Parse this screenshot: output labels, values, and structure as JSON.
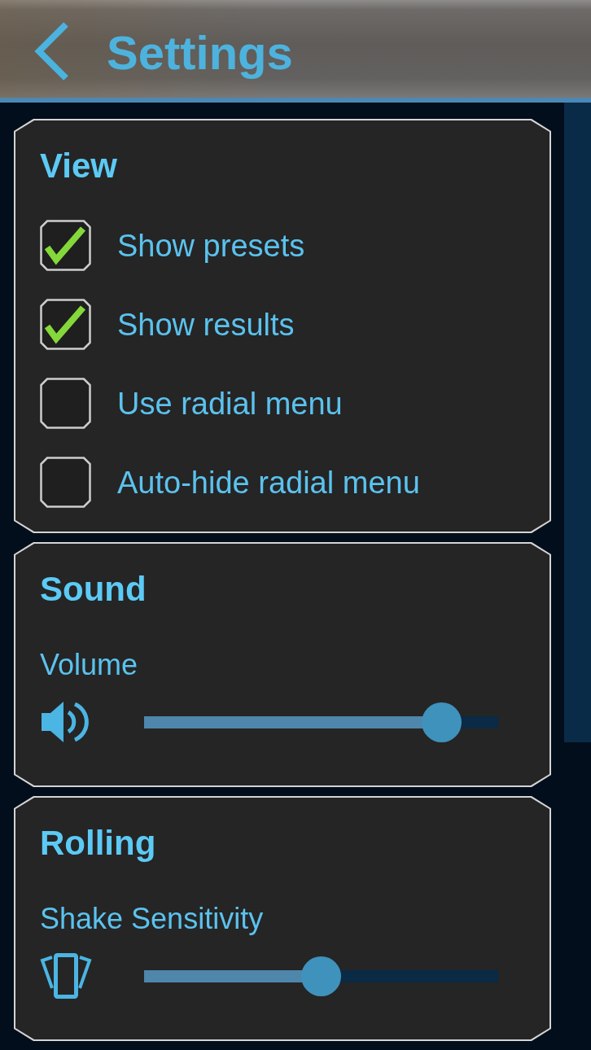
{
  "header": {
    "title": "Settings"
  },
  "sections": [
    {
      "kind": "checklist",
      "title": "View",
      "items": [
        {
          "label": "Show presets",
          "checked": true
        },
        {
          "label": "Show results",
          "checked": true
        },
        {
          "label": "Use radial menu",
          "checked": false
        },
        {
          "label": "Auto-hide radial menu",
          "checked": false
        }
      ]
    },
    {
      "kind": "slider",
      "title": "Sound",
      "label": "Volume",
      "level": 0.84
    },
    {
      "kind": "slider",
      "title": "Rolling",
      "label": "Shake Sensitivity",
      "level": 0.5
    }
  ]
}
